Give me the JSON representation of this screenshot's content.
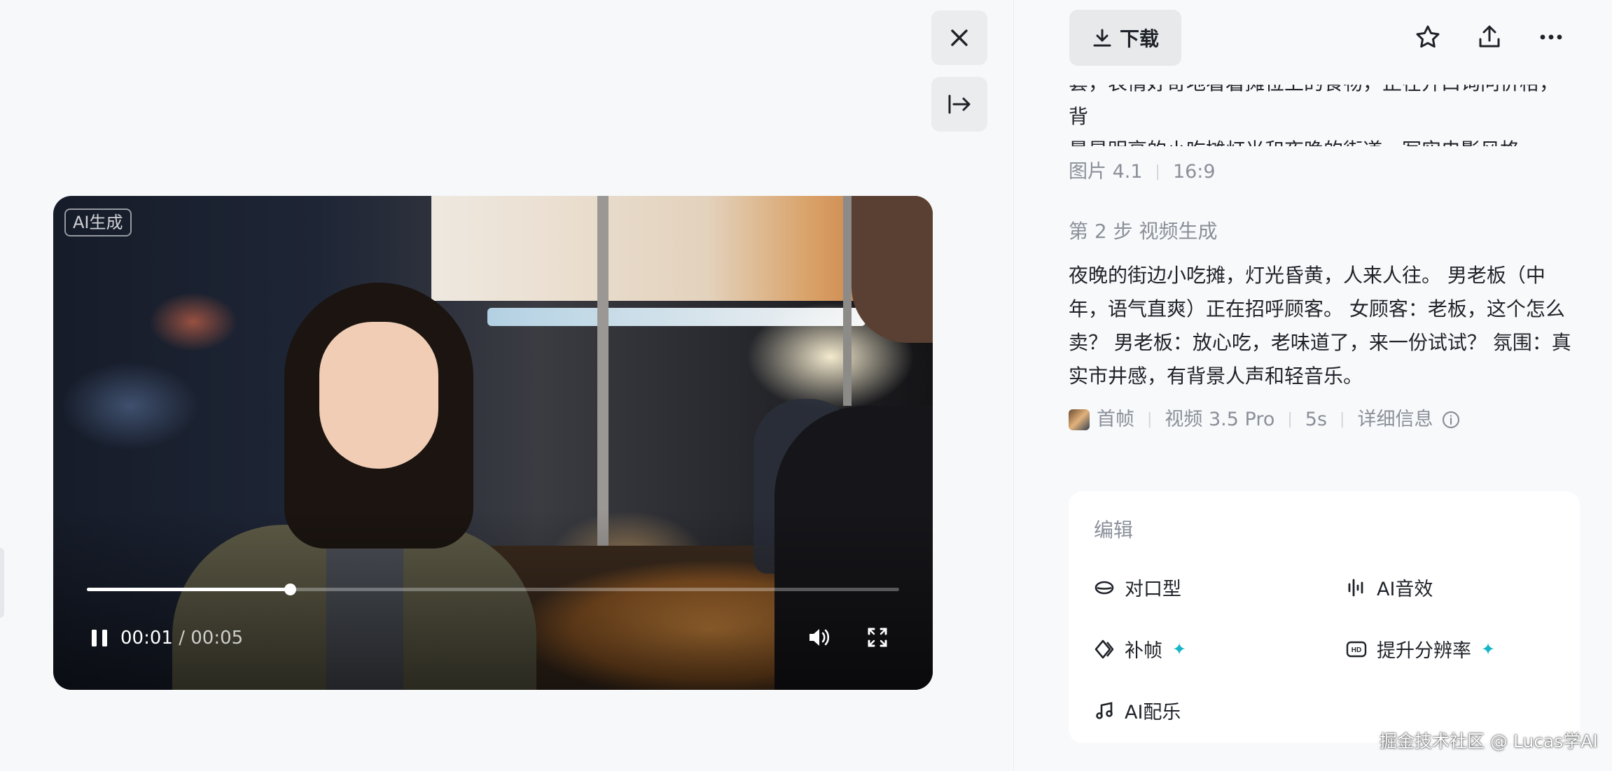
{
  "player": {
    "badge": "AI生成",
    "current_time": "00:01",
    "separator": "/",
    "duration": "00:05",
    "progress_fraction": 0.25
  },
  "toolbar": {
    "download_label": "下载",
    "icons": [
      "close-icon",
      "collapse-panel-icon",
      "download-icon",
      "star-icon",
      "share-icon",
      "more-icon"
    ]
  },
  "details": {
    "prompt_tail_line1": "套，表情好奇地看着摊位上的食物，正在开口询问价格，背",
    "prompt_tail_line2": "景是明亮的小吃摊灯光和夜晚的街道，写实电影风格。",
    "image_model": "图片 4.1",
    "aspect_ratio": "16:9",
    "step_title": "第 2 步 视频生成",
    "video_prompt": "夜晚的街边小吃摊，灯光昏黄，人来人往。 男老板（中年，语气直爽）正在招呼顾客。 女顾客：老板，这个怎么卖？ 男老板：放心吃，老味道了，来一份试试？ 氛围：真实市井感，有背景人声和轻音乐。",
    "first_frame_label": "首帧",
    "video_model": "视频 3.5 Pro",
    "video_duration": "5s",
    "more_info_label": "详细信息"
  },
  "edit": {
    "title": "编辑",
    "lip_sync": "对口型",
    "ai_sfx": "AI音效",
    "frame_interp": "补帧",
    "upscale": "提升分辨率",
    "ai_music": "AI配乐",
    "accent_color": "#16b5c7"
  },
  "watermark": "掘金技术社区 @ Lucas学AI"
}
